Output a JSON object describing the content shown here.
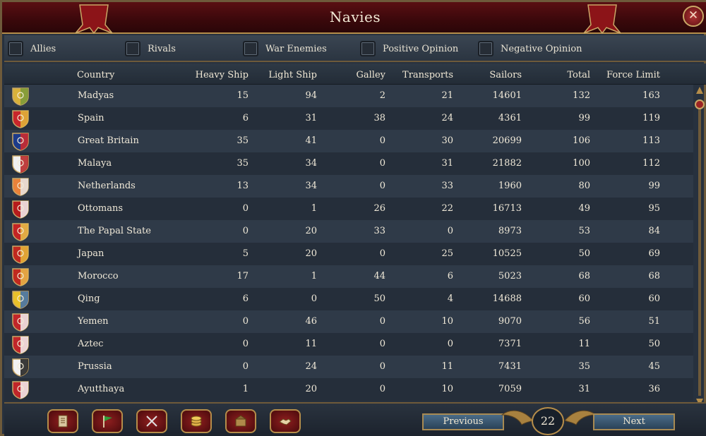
{
  "window": {
    "title": "Navies"
  },
  "filters": [
    {
      "label": "Allies"
    },
    {
      "label": "Rivals"
    },
    {
      "label": "War Enemies"
    },
    {
      "label": "Positive Opinion"
    },
    {
      "label": "Negative Opinion"
    }
  ],
  "columns": {
    "country": "Country",
    "heavy": "Heavy Ship",
    "light": "Light Ship",
    "galley": "Galley",
    "transports": "Transports",
    "sailors": "Sailors",
    "total": "Total",
    "force_limit": "Force Limit"
  },
  "rows": [
    {
      "country": "Madyas",
      "heavy": "15",
      "light": "94",
      "galley": "2",
      "transports": "21",
      "sailors": "14601",
      "total": "132",
      "force_limit": "163",
      "shield_colors": [
        "#d8b13a",
        "#7a9a3a"
      ],
      "shield_icon": "eagle-shield-icon"
    },
    {
      "country": "Spain",
      "heavy": "6",
      "light": "31",
      "galley": "38",
      "transports": "24",
      "sailors": "4361",
      "total": "99",
      "force_limit": "119",
      "shield_colors": [
        "#c8262b",
        "#e0b83a"
      ],
      "shield_icon": "quartered-shield-icon"
    },
    {
      "country": "Great Britain",
      "heavy": "35",
      "light": "41",
      "galley": "0",
      "transports": "30",
      "sailors": "20699",
      "total": "106",
      "force_limit": "113",
      "shield_colors": [
        "#1d3b8a",
        "#d42a2a"
      ],
      "shield_icon": "union-jack-shield-icon"
    },
    {
      "country": "Malaya",
      "heavy": "35",
      "light": "34",
      "galley": "0",
      "transports": "31",
      "sailors": "21882",
      "total": "100",
      "force_limit": "112",
      "shield_colors": [
        "#f0f0f0",
        "#b52020"
      ],
      "shield_icon": "quartered-shield-icon"
    },
    {
      "country": "Netherlands",
      "heavy": "13",
      "light": "34",
      "galley": "0",
      "transports": "33",
      "sailors": "1960",
      "total": "80",
      "force_limit": "99",
      "shield_colors": [
        "#e9823a",
        "#e8e8e8"
      ],
      "shield_icon": "striped-shield-icon"
    },
    {
      "country": "Ottomans",
      "heavy": "0",
      "light": "1",
      "galley": "26",
      "transports": "22",
      "sailors": "16713",
      "total": "49",
      "force_limit": "95",
      "shield_colors": [
        "#b51c1c",
        "#f2f2f2"
      ],
      "shield_icon": "crescent-shield-icon"
    },
    {
      "country": "The Papal State",
      "heavy": "0",
      "light": "20",
      "galley": "33",
      "transports": "0",
      "sailors": "8973",
      "total": "53",
      "force_limit": "84",
      "shield_colors": [
        "#c42424",
        "#e8c24a"
      ],
      "shield_icon": "keys-shield-icon"
    },
    {
      "country": "Japan",
      "heavy": "5",
      "light": "20",
      "galley": "0",
      "transports": "25",
      "sailors": "10525",
      "total": "50",
      "force_limit": "69",
      "shield_colors": [
        "#c0291f",
        "#e6b83b"
      ],
      "shield_icon": "sun-shield-icon"
    },
    {
      "country": "Morocco",
      "heavy": "17",
      "light": "1",
      "galley": "44",
      "transports": "6",
      "sailors": "5023",
      "total": "68",
      "force_limit": "68",
      "shield_colors": [
        "#c0291f",
        "#e8b94a"
      ],
      "shield_icon": "star-shield-icon"
    },
    {
      "country": "Qing",
      "heavy": "6",
      "light": "0",
      "galley": "50",
      "transports": "4",
      "sailors": "14688",
      "total": "60",
      "force_limit": "60",
      "shield_colors": [
        "#e8c02a",
        "#3c6fb0"
      ],
      "shield_icon": "dragon-shield-icon"
    },
    {
      "country": "Yemen",
      "heavy": "0",
      "light": "46",
      "galley": "0",
      "transports": "10",
      "sailors": "9070",
      "total": "56",
      "force_limit": "51",
      "shield_colors": [
        "#c0262a",
        "#f0f0f0"
      ],
      "shield_icon": "crescent-shield-icon"
    },
    {
      "country": "Aztec",
      "heavy": "0",
      "light": "11",
      "galley": "0",
      "transports": "0",
      "sailors": "7371",
      "total": "11",
      "force_limit": "50",
      "shield_colors": [
        "#c0262a",
        "#f2f2f2"
      ],
      "shield_icon": "glyph-shield-icon"
    },
    {
      "country": "Prussia",
      "heavy": "0",
      "light": "24",
      "galley": "0",
      "transports": "11",
      "sailors": "7431",
      "total": "35",
      "force_limit": "45",
      "shield_colors": [
        "#f2f2f2",
        "#1a1a1a"
      ],
      "shield_icon": "eagle-shield-icon"
    },
    {
      "country": "Ayutthaya",
      "heavy": "1",
      "light": "20",
      "galley": "0",
      "transports": "10",
      "sailors": "7059",
      "total": "31",
      "force_limit": "36",
      "shield_colors": [
        "#c0262a",
        "#f2f2f2"
      ],
      "shield_icon": "elephant-shield-icon"
    }
  ],
  "pagination": {
    "previous": "Previous",
    "next": "Next",
    "page": "22"
  },
  "bottom_icons": [
    "ledger-icon",
    "flag-icon",
    "crossed-swords-icon",
    "coins-icon",
    "trade-goods-icon",
    "handshake-icon"
  ],
  "colors": {
    "accent_gold": "#b58d4a",
    "title_red": "#5a0f12",
    "row_even": "#2f3a48",
    "row_odd": "#252e3a"
  }
}
